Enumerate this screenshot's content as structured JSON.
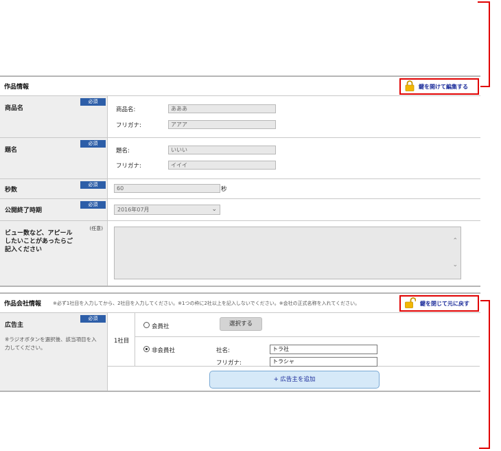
{
  "product_section": {
    "title": "作品情報",
    "lock_button": "鍵を開けて編集する",
    "rows": {
      "product_name": {
        "label": "商品名",
        "badge": "必須",
        "name_label": "商品名:",
        "name_value": "あああ",
        "kana_label": "フリガナ:",
        "kana_value": "アアア"
      },
      "title": {
        "label": "題名",
        "badge": "必須",
        "name_label": "題名:",
        "name_value": "いいい",
        "kana_label": "フリガナ:",
        "kana_value": "イイイ"
      },
      "seconds": {
        "label": "秒数",
        "badge": "必須",
        "value": "60",
        "unit": "秒"
      },
      "end_period": {
        "label": "公開終了時期",
        "badge": "必須",
        "selected": "2016年07月"
      },
      "appeal": {
        "label": "ビュー数など、アピールしたいことがあったらご記入ください",
        "badge": "(任意)",
        "value": ""
      }
    }
  },
  "company_section": {
    "title": "作品会社情報",
    "note": "※必ず1社目を入力してから、2社目を入力してください。※1つの枠に2社以上を記入しないでください。※会社の正式名称を入れてください。",
    "lock_button": "鍵を閉じて元に戻す",
    "advertiser": {
      "label": "広告主",
      "badge": "必須",
      "sub": "※ラジオボタンを選択後、該当項目を入力してください。",
      "company_index": "1社目",
      "member_label": "会員社",
      "select_button": "選択する",
      "nonmember_label": "非会員社",
      "company_name_label": "社名:",
      "company_name_value": "トラ社",
      "kana_label": "フリガナ:",
      "kana_value": "トラシャ",
      "add_button": "+ 広告主を追加"
    }
  },
  "colors": {
    "callout": "#e00000",
    "badge": "#2d5ea8",
    "link": "#1a2b9a",
    "lock": "#f2b705"
  }
}
